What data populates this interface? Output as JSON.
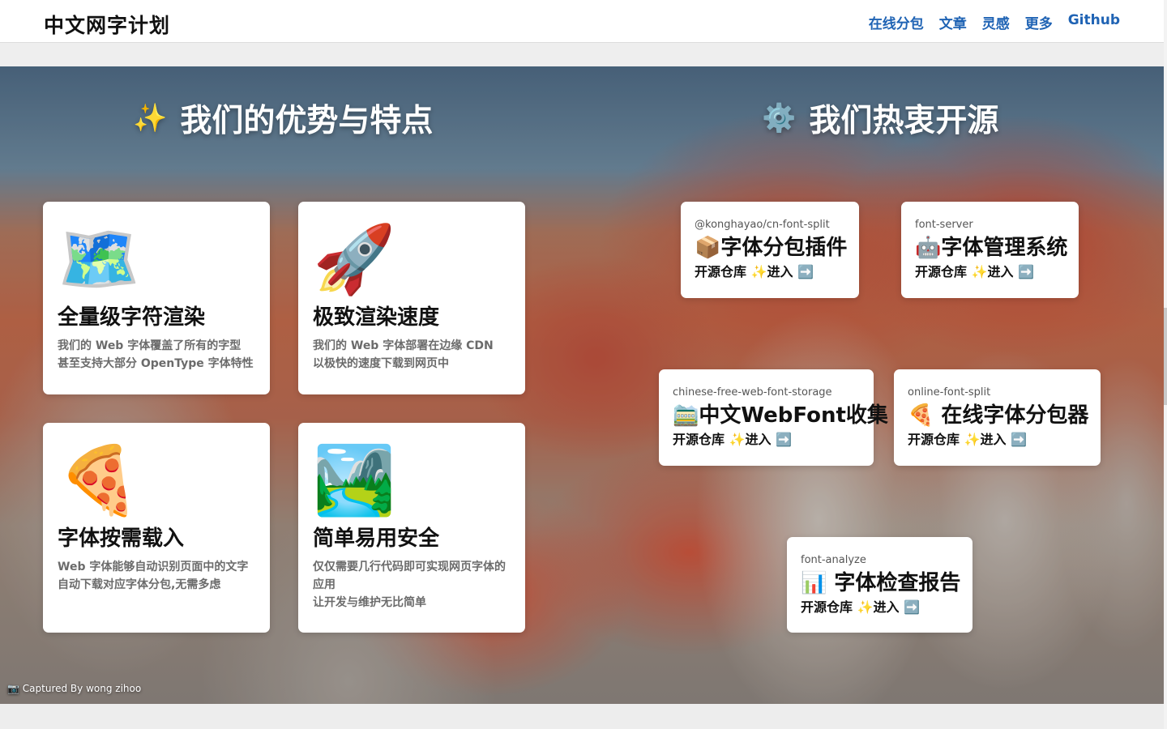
{
  "header": {
    "brand": "中文网字计划",
    "nav": [
      "在线分包",
      "文章",
      "灵感",
      "更多",
      "Github"
    ]
  },
  "features_section": {
    "icon": "✨",
    "title": "我们的优势与特点",
    "cards": [
      {
        "emoji": "🗺️",
        "icon_name": "world-map-icon",
        "title": "全量级字符渲染",
        "lines": [
          "我们的 Web 字体覆盖了所有的字型",
          "甚至支持大部分 OpenType 字体特性"
        ]
      },
      {
        "emoji": "🚀",
        "icon_name": "rocket-icon",
        "title": "极致渲染速度",
        "lines": [
          "我们的 Web 字体部署在边缘 CDN",
          "以极快的速度下载到网页中"
        ]
      },
      {
        "emoji": "🍕",
        "icon_name": "pizza-icon",
        "title": "字体按需载入",
        "lines": [
          "Web 字体能够自动识别页面中的文字",
          "自动下载对应字体分包,无需多虑"
        ]
      },
      {
        "emoji": "🏞️",
        "icon_name": "landscape-icon",
        "title": "简单易用安全",
        "lines": [
          "仅仅需要几行代码即可实现网页字体的应用",
          "让开发与维护无比简单"
        ]
      }
    ]
  },
  "opensource_section": {
    "icon": "⚙️",
    "title": "我们热衷开源",
    "cards": [
      {
        "package": "@konghayao/cn-font-split",
        "emoji": "📦",
        "title": "字体分包插件",
        "repo": "开源仓库",
        "enter": "✨进入",
        "arrow": "➡️"
      },
      {
        "package": "font-server",
        "emoji": "🤖",
        "title": "字体管理系统",
        "repo": "开源仓库",
        "enter": "✨进入",
        "arrow": "➡️"
      },
      {
        "package": "chinese-free-web-font-storage",
        "emoji": "🚞",
        "title": "中文WebFont收集",
        "repo": "开源仓库",
        "enter": "✨进入",
        "arrow": "➡️"
      },
      {
        "package": "online-font-split",
        "emoji": "🍕",
        "title": " 在线字体分包器",
        "repo": "开源仓库",
        "enter": "✨进入",
        "arrow": "➡️"
      },
      {
        "package": "font-analyze",
        "emoji": "📊",
        "title": " 字体检查报告",
        "repo": "开源仓库",
        "enter": "✨进入",
        "arrow": "➡️"
      }
    ]
  },
  "photo_credit": {
    "icon": "📷",
    "text": "Captured By wong zihoo"
  },
  "colors": {
    "nav_link": "#1f63b4",
    "card_bg": "#ffffff",
    "desc_text": "#6b6b6b"
  }
}
